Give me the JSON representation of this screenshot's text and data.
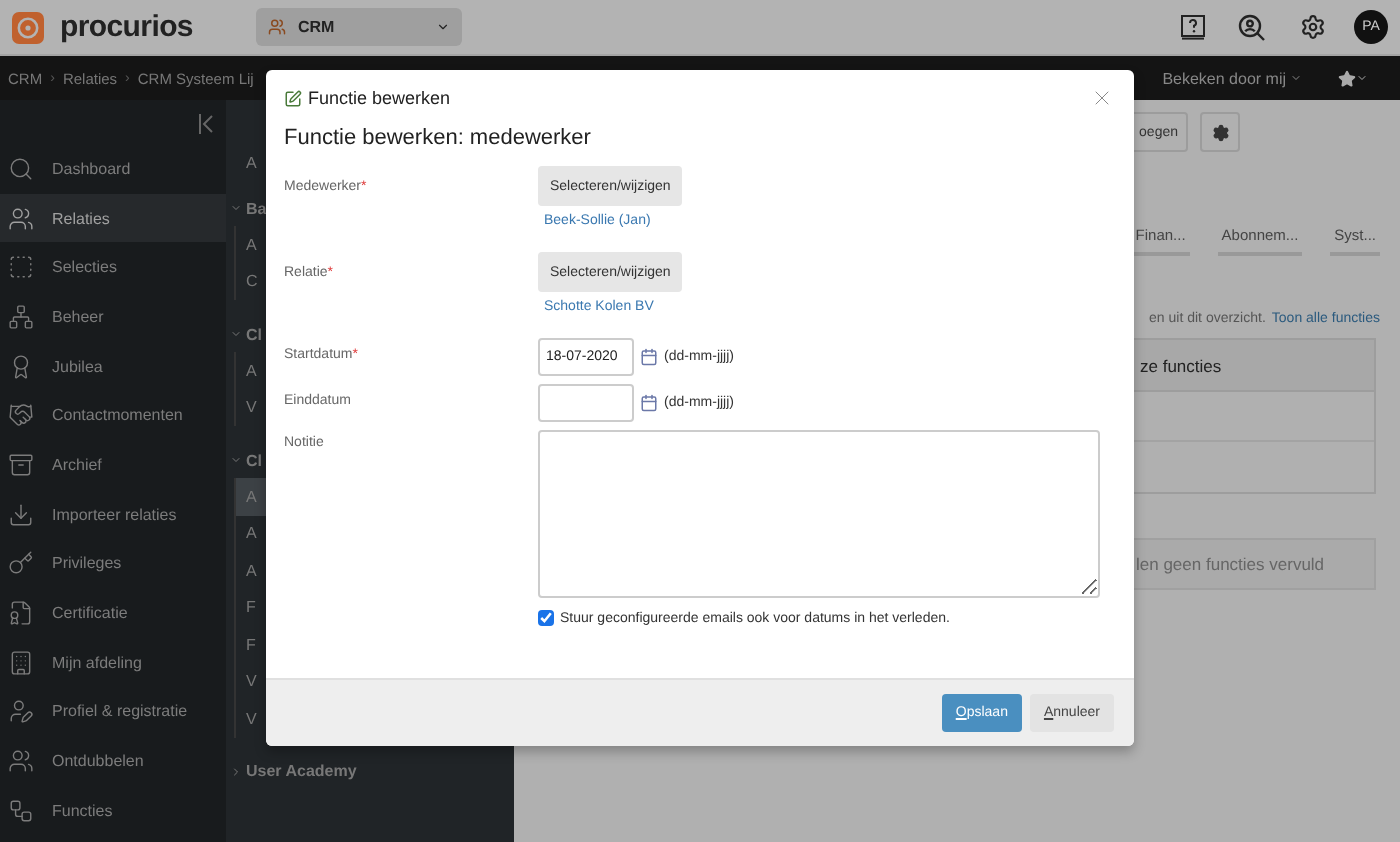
{
  "header": {
    "logo_text": "procurios",
    "app_switcher": {
      "label": "CRM"
    },
    "avatar": "PA"
  },
  "breadcrumb": {
    "separator": "›",
    "items": [
      "CRM",
      "Relaties",
      "CRM Systeem Lij"
    ],
    "right_menu": "Bekeken door mij"
  },
  "sidebar": {
    "items": [
      {
        "label": "Dashboard",
        "selected": false
      },
      {
        "label": "Relaties",
        "selected": true
      },
      {
        "label": "Selecties",
        "selected": false
      },
      {
        "label": "Beheer",
        "selected": false
      },
      {
        "label": "Jubilea",
        "selected": false
      },
      {
        "label": "Contactmomenten",
        "selected": false
      },
      {
        "label": "Archief",
        "selected": false
      },
      {
        "label": "Importeer relaties",
        "selected": false
      },
      {
        "label": "Privileges",
        "selected": false
      },
      {
        "label": "Certificatie",
        "selected": false
      },
      {
        "label": "Mijn afdeling",
        "selected": false
      },
      {
        "label": "Profiel & registratie",
        "selected": false
      },
      {
        "label": "Ontdubbelen",
        "selected": false
      },
      {
        "label": "Functies",
        "selected": false
      }
    ]
  },
  "submenu": {
    "items": [
      {
        "kind": "title",
        "label": "A"
      },
      {
        "kind": "header",
        "label": "Ba",
        "expanded": true
      },
      {
        "kind": "child",
        "label": "A",
        "selected": false
      },
      {
        "kind": "child",
        "label": "C",
        "selected": false
      },
      {
        "kind": "header",
        "label": "Cl",
        "expanded": true
      },
      {
        "kind": "child",
        "label": "A",
        "selected": false
      },
      {
        "kind": "child",
        "label": "V",
        "selected": false
      },
      {
        "kind": "header",
        "label": "Cl",
        "expanded": true
      },
      {
        "kind": "child",
        "label": "A",
        "selected": true
      },
      {
        "kind": "child",
        "label": "A",
        "selected": false
      },
      {
        "kind": "child",
        "label": "A",
        "selected": false
      },
      {
        "kind": "child",
        "label": "F",
        "selected": false
      },
      {
        "kind": "child",
        "label": "F",
        "selected": false
      },
      {
        "kind": "child",
        "label": "V",
        "selected": false
      },
      {
        "kind": "child",
        "label": "V",
        "selected": false
      },
      {
        "kind": "header",
        "label": "User Academy",
        "expanded": false
      }
    ]
  },
  "main": {
    "toolbar_button": "oegen",
    "tabs": [
      "Finan...",
      "Abonnem...",
      "Syst..."
    ],
    "info_text": "en uit dit overzicht.",
    "info_link": "Toon alle functies",
    "table": {
      "columns": [
        "ze functies"
      ]
    },
    "empty_message": "len geen functies vervuld"
  },
  "dialog": {
    "title": "Functie bewerken",
    "heading": "Functie bewerken: medewerker",
    "fields": [
      {
        "kind": "picker",
        "label": "Medewerker",
        "mark": "*",
        "button": "Selecteren/wijzigen",
        "value": "Beek-Sollie (Jan)"
      },
      {
        "kind": "picker",
        "label": "Relatie",
        "mark": "*",
        "button": "Selecteren/wijzigen",
        "value": "Schotte Kolen BV"
      },
      {
        "kind": "date",
        "label": "Startdatum",
        "mark": "*",
        "value": "18-07-2020",
        "hint": "(dd-mm-jjjj)"
      },
      {
        "kind": "date",
        "label": "Einddatum",
        "hint": "(dd-mm-jjjj)"
      },
      {
        "kind": "textarea",
        "label": "Notitie"
      }
    ],
    "checkbox": {
      "label": "Stuur geconfigureerde emails ook voor datums in het verleden.",
      "checked": true
    },
    "buttons": [
      {
        "label": "Opslaan",
        "kind": "primary"
      },
      {
        "label": "Annuleer",
        "kind": "secondary"
      }
    ]
  }
}
